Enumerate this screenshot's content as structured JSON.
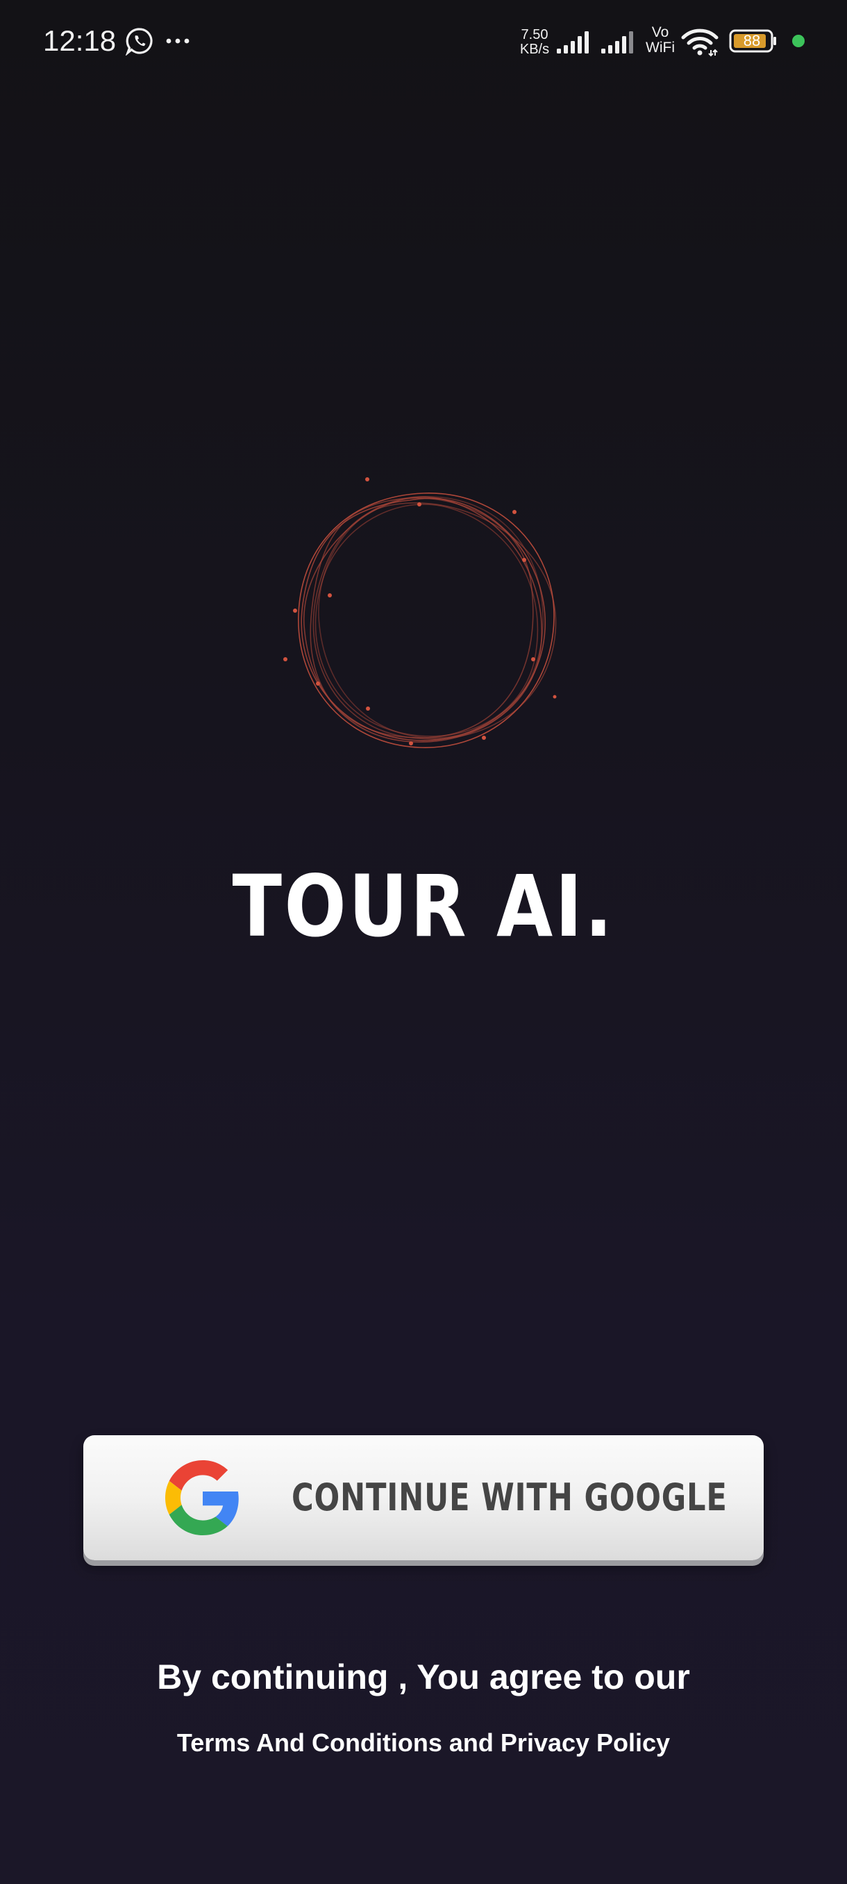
{
  "status_bar": {
    "time": "12:18",
    "net_speed_value": "7.50",
    "net_speed_unit": "KB/s",
    "vo_top": "Vo",
    "vo_bottom": "WiFi",
    "battery_level": "88",
    "icons": [
      "whatsapp-icon",
      "more-dots-icon",
      "signal-icon",
      "signal-icon",
      "wifi-icon",
      "battery-icon"
    ],
    "indicator_color": "#3cc35a"
  },
  "hero": {
    "logo_icon": "animated-orb",
    "accent_color": "#d2533f"
  },
  "app": {
    "title": "TOUR AI."
  },
  "login": {
    "google_button_label": "CONTINUE WITH GOOGLE",
    "google_icon": "google-g-icon"
  },
  "footer": {
    "agree_text": "By continuing , You agree to our",
    "terms_link": "Terms And Conditions and Privacy Policy"
  }
}
